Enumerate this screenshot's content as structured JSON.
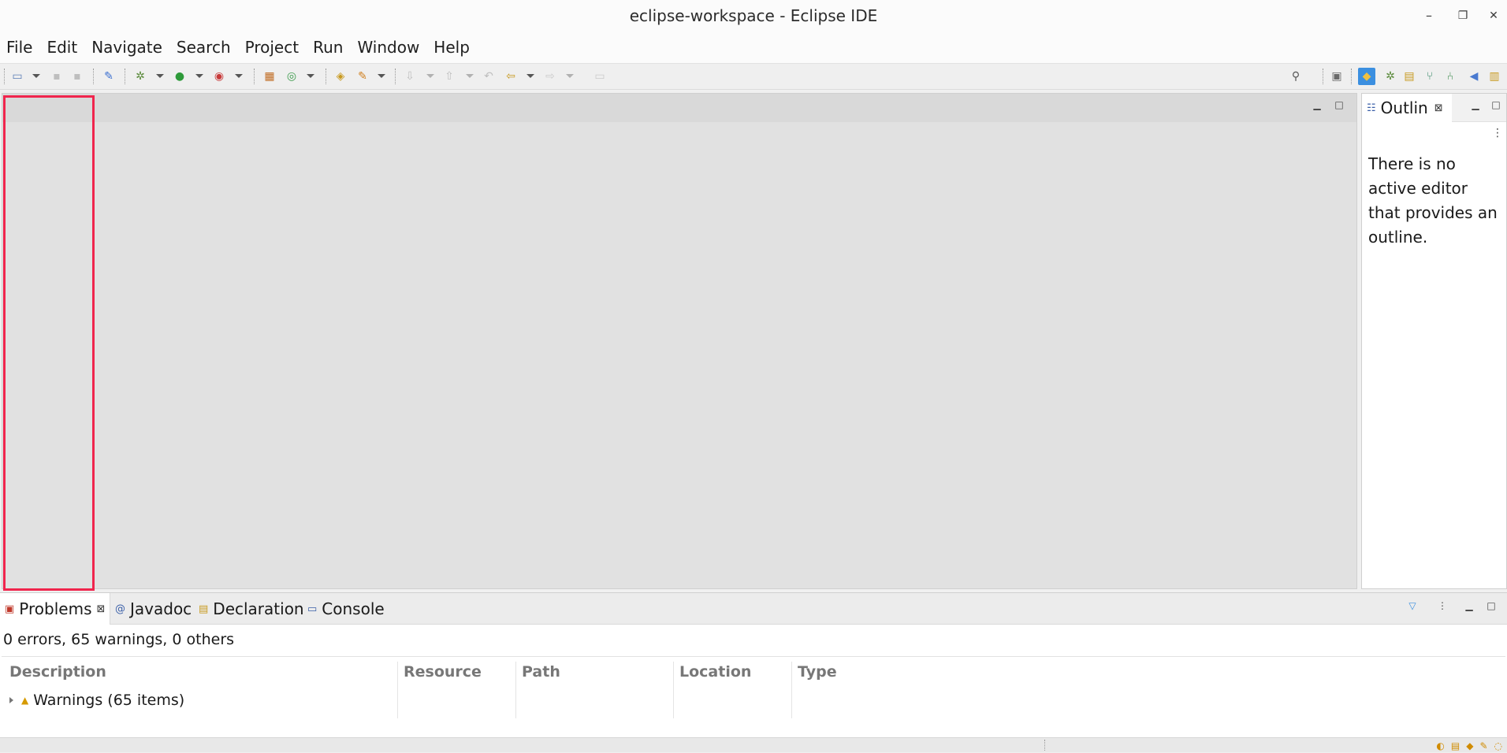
{
  "window": {
    "title": "eclipse-workspace - Eclipse IDE",
    "minimize": "–",
    "restore": "❐",
    "close": "✕"
  },
  "menu": [
    "File",
    "Edit",
    "Navigate",
    "Search",
    "Project",
    "Run",
    "Window",
    "Help"
  ],
  "outline": {
    "tab_label": "Outlin",
    "message": "There is no active editor that provides an outline."
  },
  "bottom_panel": {
    "tabs": [
      {
        "label": "Problems",
        "icon": "problems-icon"
      },
      {
        "label": "Javadoc",
        "icon": "javadoc-icon"
      },
      {
        "label": "Declaration",
        "icon": "declaration-icon"
      },
      {
        "label": "Console",
        "icon": "console-icon"
      }
    ],
    "summary": "0 errors, 65 warnings, 0 others",
    "columns": [
      "Description",
      "Resource",
      "Path",
      "Location",
      "Type"
    ],
    "rows": [
      {
        "description": "Warnings (65 items)"
      }
    ]
  },
  "colors": {
    "highlight": "#f0254d",
    "active_toolbar": "#3b8fe0"
  }
}
